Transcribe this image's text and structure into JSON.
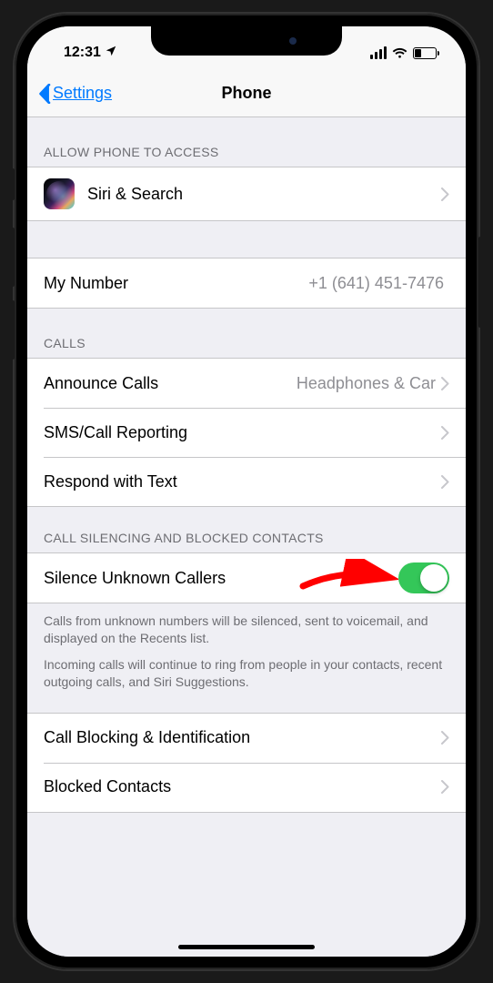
{
  "status": {
    "time": "12:31",
    "location_glyph": true
  },
  "nav": {
    "back_label": "Settings",
    "title": "Phone"
  },
  "sections": {
    "access_header": "ALLOW PHONE TO ACCESS",
    "siri_label": "Siri & Search",
    "my_number_label": "My Number",
    "my_number_value": "+1 (641) 451-7476",
    "calls_header": "CALLS",
    "announce_label": "Announce Calls",
    "announce_value": "Headphones & Car",
    "sms_label": "SMS/Call Reporting",
    "respond_label": "Respond with Text",
    "silencing_header": "CALL SILENCING AND BLOCKED CONTACTS",
    "silence_label": "Silence Unknown Callers",
    "silence_toggle_on": true,
    "footer_1": "Calls from unknown numbers will be silenced, sent to voicemail, and displayed on the Recents list.",
    "footer_2": "Incoming calls will continue to ring from people in your contacts, recent outgoing calls, and Siri Suggestions.",
    "blocking_label": "Call Blocking & Identification",
    "blocked_label": "Blocked Contacts"
  },
  "annotation": {
    "arrow_color": "#ff0000"
  }
}
